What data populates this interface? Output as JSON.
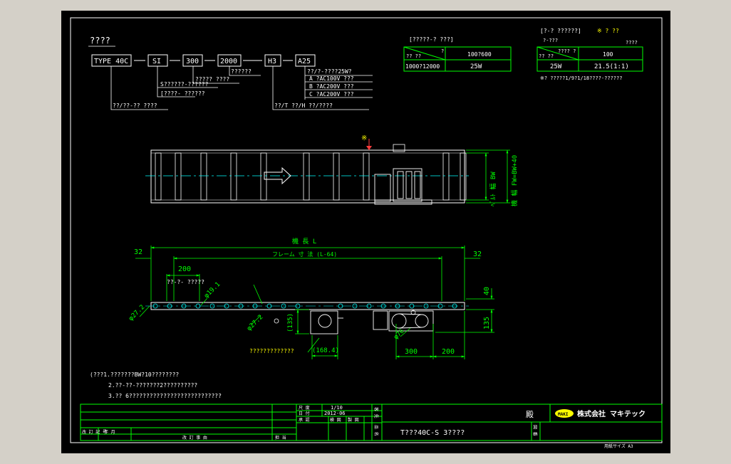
{
  "colors": {
    "background": "#000000",
    "border": "#ffffff",
    "table": "#00ff00",
    "text": "#ffffff",
    "dimension": "#00ff00",
    "centerline": "#00ffff",
    "conveyor": "#00ffff",
    "accent": "#ffff00",
    "marker": "#ff3b3b",
    "outer": "#d4d0c8"
  },
  "model": {
    "title": "????",
    "codes": [
      "TYPE 40C",
      "SI",
      "300",
      "2000",
      "H3",
      "A25"
    ],
    "notes": {
      "si_a": "S??????-??????",
      "si_b": "[????- ??????",
      "bw": "?????  ????",
      "length": "??????",
      "speed_h3": "??/T   ??/H   ??/????",
      "type_note": "??/??-?? ????",
      "motor_head": "??/?-????25W?",
      "motor_a": "A  ?AC100V  ???",
      "motor_b": "B  ?AC200V  ???",
      "motor_c": "C  ?AC200V  ???"
    }
  },
  "table_left": {
    "title": "[?????-?  ???]",
    "diag_top": "?",
    "diag_bottom": "?? ??",
    "col1_header": "??  ??",
    "col2_header": "100?600",
    "row_label": "1000?12000",
    "row_value": "25W"
  },
  "table_right": {
    "title": "[?-?  ??????]",
    "note_head": "※ ?  ??",
    "note_sub": "????",
    "diag_top": "????  ?",
    "diag_bottom": "?-???",
    "col1_header": "??  ??",
    "col2_header": "100",
    "row_label": "25W",
    "row_value": "21.5(1:1)",
    "footnote": "※?  ?????1/9?1/18????-??????"
  },
  "top_view": {
    "marker": "※",
    "bw_label": "ﾍﾞﾙﾄ 幅  BW",
    "fw_label": "機 幅 FW=BW+40"
  },
  "side_view": {
    "length_label": "機 長  L",
    "frame_label": "フレーム  寸 法 (L-64)",
    "dim_32_left": "32",
    "dim_32_right": "32",
    "dim_200": "200",
    "pitch_label": "??-?-  ?????",
    "d191": "φ19.1",
    "d272_left": "φ27.2",
    "d272_mid": "φ27.2",
    "dim_135_left": "(135)",
    "dim_1684": "(168.4)",
    "d76": "φ76",
    "dim_300": "300",
    "dim_200b": "200",
    "dim_40": "40",
    "dim_135_right": "135",
    "motor_note": "?????????????"
  },
  "notes": [
    "(???1.???????BW?10????????",
    "2.??-??-???????2??????????",
    "3.??  6???????????????????????????"
  ],
  "title_block": {
    "scale_label": "尺  度",
    "scale_value": "1/10",
    "date_label": "日  付",
    "date_value": "2012-06",
    "drafter": "承 認",
    "checker": "検 図",
    "designer": "製 図",
    "revision_label": "改 訂 記 号",
    "rev_date": "年 月",
    "revision_content": "改  訂  事  由",
    "person": "担 当",
    "customer_label": "客 先",
    "customer_suffix": "殿",
    "logo_mark": "MAKI",
    "company": "株式会社 マキテック",
    "drawing_name_label": "品 名",
    "drawing_name": "T???40C-S  3????",
    "drawing_no_label": "図 番",
    "paper_size": "用紙サイズ A3"
  }
}
